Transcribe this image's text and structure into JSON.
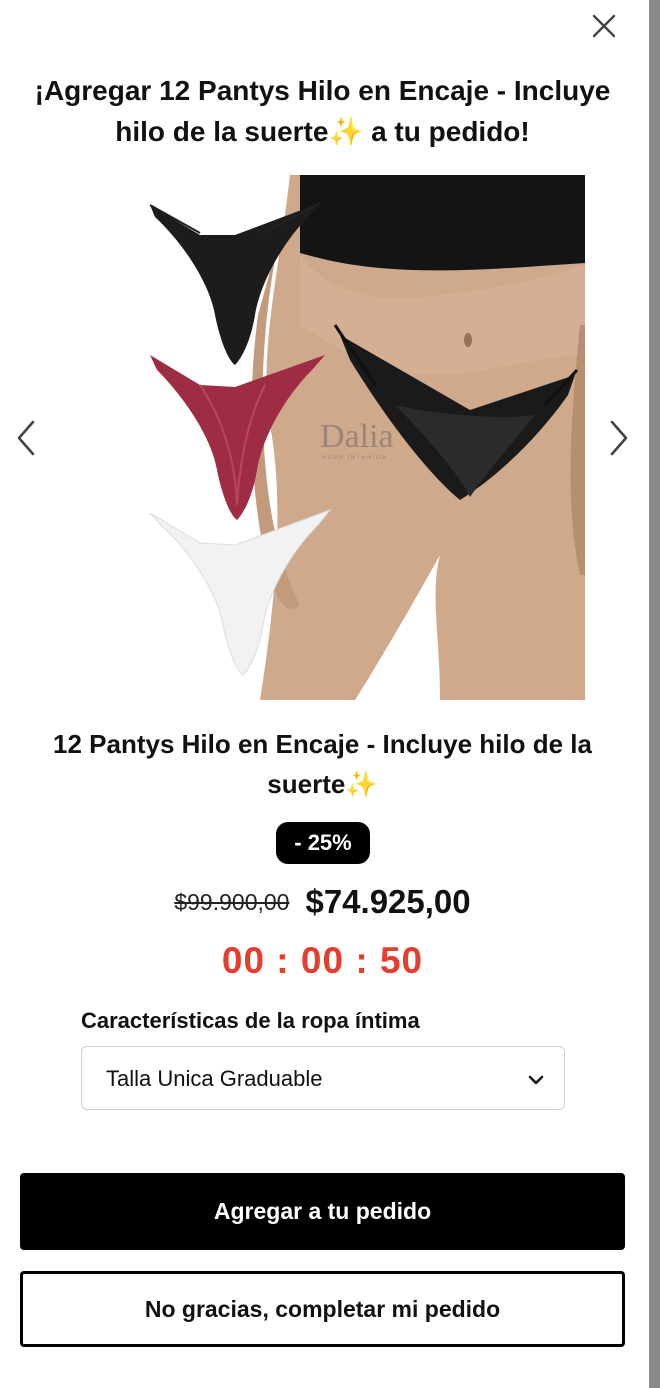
{
  "modal": {
    "title": "¡Agregar 12 Pantys Hilo en Encaje - Incluye hilo de la suerte✨ a tu pedido!",
    "product_name": "12 Pantys Hilo en Encaje - Incluye hilo de la suerte✨",
    "image_watermark": "Dalia",
    "image_watermark_sub": "ROPA INTERIOR",
    "discount_badge": "- 25%",
    "price_original": "$99.900,00",
    "price_current": "$74.925,00",
    "countdown": "00 : 00 : 50",
    "variant_label": "Características de la ropa íntima",
    "variant_selected": "Talla Unica Graduable",
    "add_button": "Agregar a tu pedido",
    "decline_button": "No gracias, completar mi pedido"
  },
  "colors": {
    "accent_timer": "#e53e2e",
    "button_primary_bg": "#000000",
    "badge_bg": "#000000"
  },
  "icons": {
    "close": "close-icon",
    "prev": "chevron-left-icon",
    "next": "chevron-right-icon",
    "select": "chevron-down-icon"
  }
}
